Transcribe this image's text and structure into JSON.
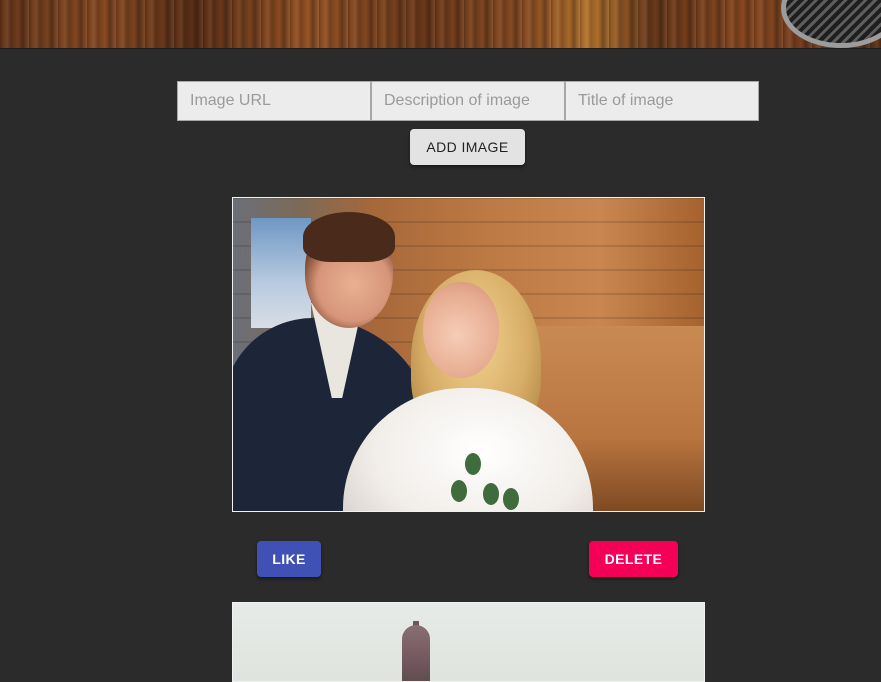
{
  "form": {
    "url_placeholder": "Image URL",
    "description_placeholder": "Description of image",
    "title_placeholder": "Title of image",
    "add_button_label": "ADD IMAGE"
  },
  "cards": [
    {
      "like_label": "LIKE",
      "delete_label": "DELETE"
    }
  ],
  "colors": {
    "background": "#2b2b2b",
    "like": "#3f51b5",
    "delete": "#f50057"
  }
}
